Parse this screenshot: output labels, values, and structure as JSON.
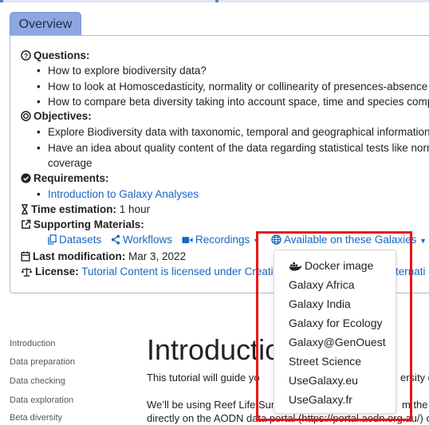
{
  "overview_tab": "Overview",
  "questions": {
    "label": "Questions:",
    "items": [
      "How to explore biodiversity data?",
      "How to look at Homoscedasticity, normality or collinearity of presences-absence or a",
      "How to compare beta diversity taking into account space, time and species compon"
    ]
  },
  "objectives": {
    "label": "Objectives:",
    "items": [
      "Explore Biodiversity data with taxonomic, temporal and geographical informations",
      "Have an idea about quality content of the data regarding statistical tests like normal",
      "coverage"
    ]
  },
  "requirements": {
    "label": "Requirements:",
    "items": [
      "Introduction to Galaxy Analyses"
    ]
  },
  "time_estimation": {
    "label": "Time estimation:",
    "value": "1 hour"
  },
  "supporting": {
    "label": "Supporting Materials:",
    "datasets": "Datasets",
    "workflows": "Workflows",
    "recordings": "Recordings",
    "galaxies": "Available on these Galaxies"
  },
  "last_modification": {
    "label": "Last modification:",
    "value": "Mar 3, 2022"
  },
  "license": {
    "label": "License:",
    "value": "Tutorial Content is licensed under Creative",
    "value_tail": "ternati"
  },
  "dropdown_items": [
    "Docker image",
    "Galaxy Africa",
    "Galaxy India",
    "Galaxy for Ecology",
    "Galaxy@GenOuest",
    "Street Science",
    "UseGalaxy.eu",
    "UseGalaxy.fr"
  ],
  "sidebar": [
    "Introduction",
    "Data preparation",
    "Data checking",
    "Data exploration",
    "Beta diversity"
  ],
  "content": {
    "title": "Introductio",
    "line1": "This tutorial will guide yo",
    "line1_tail": "ersity da",
    "line2": "We’ll be using Reef Life Surv",
    "line2_tail": "m the A",
    "line3": "directly on the AODN data portal (https://portal.aodn.org.au/) c"
  },
  "colors": {
    "link": "#1767c2",
    "tab": "#8ea7e3",
    "highlight": "#e8141c"
  }
}
